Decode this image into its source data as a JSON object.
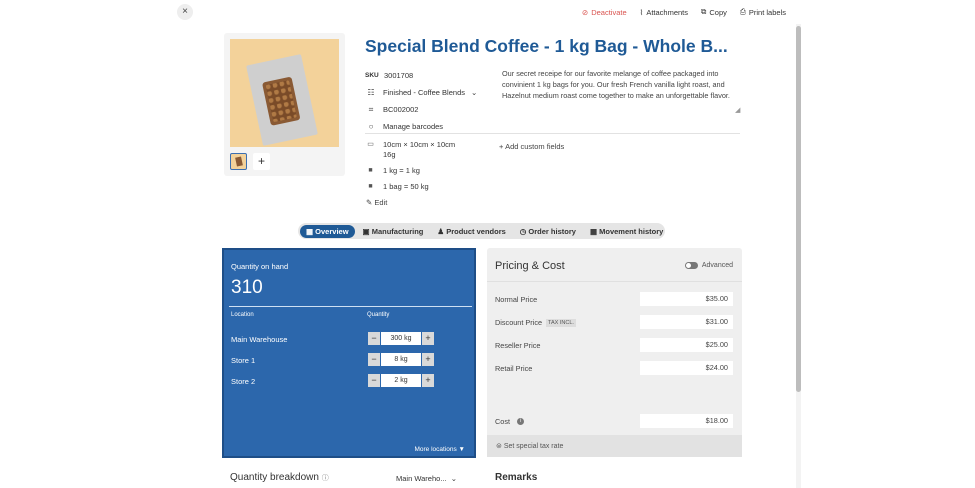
{
  "toolbar": {
    "close_label": "×",
    "deactivate_label": "Deactivate",
    "attachments_label": "Attachments",
    "copy_label": "Copy",
    "print_labels_label": "Print labels"
  },
  "product": {
    "title": "Special Blend Coffee - 1 kg Bag - Whole B...",
    "sku_label": "SKU",
    "sku": "3001708",
    "category": "Finished - Coffee Blends",
    "barcode": "BC002002",
    "manage_barcodes": "Manage barcodes",
    "description": "Our secret receipe for our favorite melange of coffee packaged into convinient 1 kg bags for you. Our fresh French vanilla light roast, and Hazelnut medium roast come together to make an unforgettable flavor.",
    "dimensions": "10cm × 10cm × 10cm",
    "weight": "16g",
    "unit_conversion": "1 kg = 1 kg",
    "bag_conversion": "1 bag = 50 kg",
    "add_custom_fields": "Add custom fields",
    "edit_label": "Edit",
    "add_image": "+"
  },
  "tabs": [
    {
      "label": "Overview"
    },
    {
      "label": "Manufacturing"
    },
    {
      "label": "Product vendors"
    },
    {
      "label": "Order history"
    },
    {
      "label": "Movement history"
    }
  ],
  "quantity": {
    "title": "Quantity on hand",
    "total": "310",
    "col_location": "Location",
    "col_quantity": "Quantity",
    "rows": [
      {
        "location": "Main Warehouse",
        "value": "300 kg"
      },
      {
        "location": "Store 1",
        "value": "8 kg"
      },
      {
        "location": "Store 2",
        "value": "2 kg"
      }
    ],
    "minus": "−",
    "plus": "+",
    "more_locations": "More locations ▼"
  },
  "pricing": {
    "title": "Pricing & Cost",
    "advanced_label": "Advanced",
    "rows": [
      {
        "label": "Normal Price",
        "value": "$35.00"
      },
      {
        "label": "Discount Price",
        "value": "$31.00",
        "badge": "TAX INCL."
      },
      {
        "label": "Reseller Price",
        "value": "$25.00"
      },
      {
        "label": "Retail Price",
        "value": "$24.00"
      }
    ],
    "cost_label": "Cost",
    "cost_value": "$18.00",
    "tax_link": "Set special tax rate"
  },
  "bottom": {
    "quantity_breakdown": "Quantity breakdown",
    "location_select": "Main Wareho...",
    "remarks": "Remarks"
  }
}
